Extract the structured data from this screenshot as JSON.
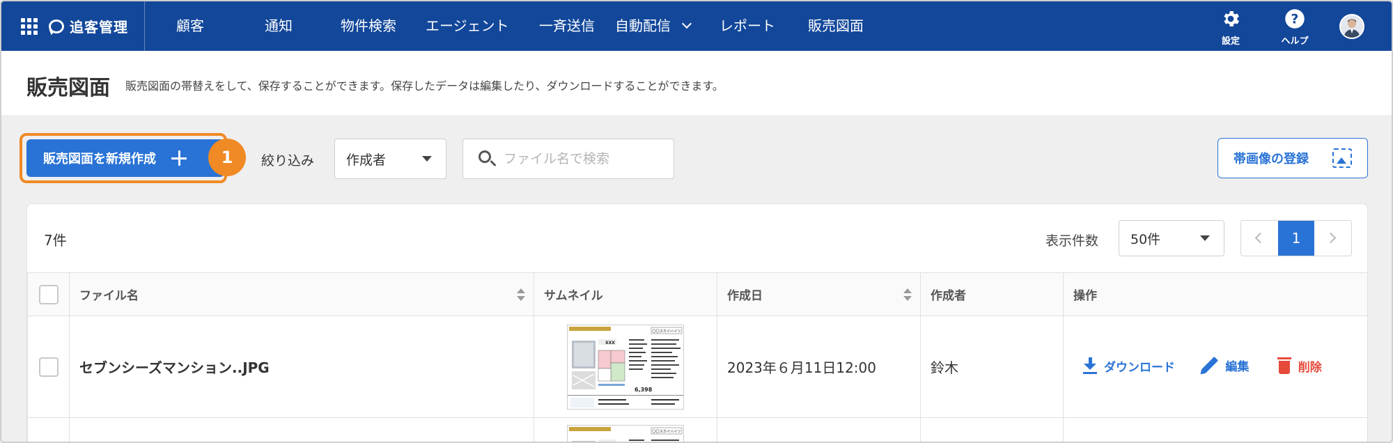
{
  "nav": {
    "brand": "追客管理",
    "items": [
      "顧客",
      "通知",
      "物件検索",
      "エージェント",
      "一斉送信",
      "自動配信",
      "レポート",
      "販売図面"
    ],
    "settings_label": "設定",
    "help_label": "ヘルプ"
  },
  "header": {
    "title": "販売図面",
    "description": "販売図面の帯替えをして、保存することができます。保存したデータは編集したり、ダウンロードすることができます。"
  },
  "toolbar": {
    "create_label": "販売図面を新規作成",
    "step_badge": "1",
    "filter_label": "絞り込み",
    "filter_value": "作成者",
    "search_placeholder": "ファイル名で検索",
    "banner_label": "帯画像の登録"
  },
  "list": {
    "count": "7件",
    "perpage_label": "表示件数",
    "perpage_value": "50件",
    "current_page": "1",
    "columns": [
      "ファイル名",
      "サムネイル",
      "作成日",
      "作成者",
      "操作"
    ],
    "rows": [
      {
        "file_name": "セブンシーズマンション..JPG",
        "created": "2023年６月11日12:00",
        "author": "鈴木",
        "actions": [
          "ダウンロード",
          "編集",
          "削除"
        ]
      }
    ]
  },
  "thumbnail": {
    "header_text": "〇〇スカイハイツ",
    "price": "6,398"
  },
  "colors": {
    "nav_bg": "#12479a",
    "primary": "#2a73d6",
    "highlight": "#f08a24",
    "danger": "#e64a3b"
  }
}
